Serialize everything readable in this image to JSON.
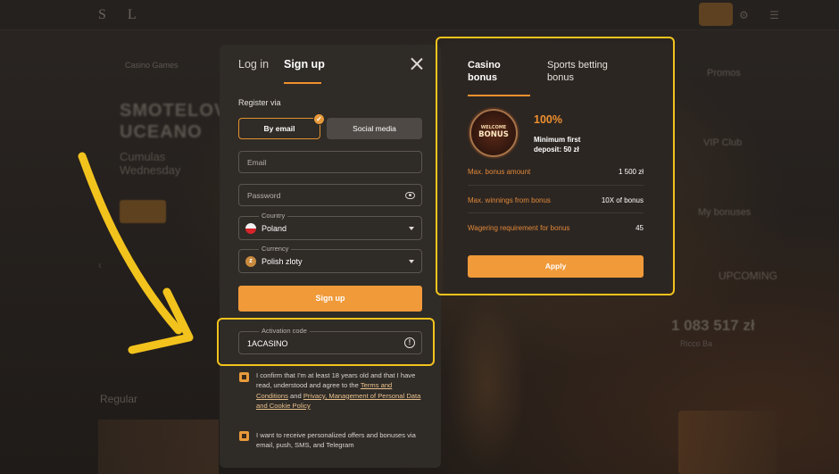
{
  "modal": {
    "tabs": {
      "login": "Log in",
      "signup": "Sign up"
    },
    "register_via": "Register via",
    "by_email": "By email",
    "social_media": "Social media",
    "email_placeholder": "Email",
    "password_placeholder": "Password",
    "country_label": "Country",
    "country_value": "Poland",
    "currency_label": "Currency",
    "currency_value": "Polish zloty",
    "signup_button": "Sign up",
    "activation_label": "Activation code",
    "activation_value": "1ACASINO",
    "consent1_text": "I confirm that I'm at least 18 years old and that I have read, understood and agree to the",
    "consent1_link1": "Terms and Conditions",
    "consent1_and": "and",
    "consent1_link2": "Privacy, Management of Personal Data and Cookie Policy",
    "consent2_text": "I want to receive personalized offers and bonuses via email, push, SMS, and Telegram",
    "icons": {
      "close": "close-icon",
      "eye": "eye-icon",
      "flag": "poland-flag-icon",
      "coin": "coin-icon",
      "caret": "chevron-down-icon",
      "info": "info-icon",
      "check": "check-icon"
    }
  },
  "bonus": {
    "tab_casino": "Casino bonus",
    "tab_sports": "Sports betting bonus",
    "badge_line1": "WELCOME",
    "badge_line2": "BONUS",
    "percent": "100%",
    "min_deposit": "Minimum first deposit: 50 zł",
    "rows": [
      {
        "label": "Max. bonus amount",
        "value": "1 500 zł"
      },
      {
        "label": "Max. winnings from bonus",
        "value": "10X of bonus"
      },
      {
        "label": "Wagering requirement for bonus",
        "value": "45"
      }
    ],
    "apply": "Apply"
  },
  "background": {
    "logo": "S L",
    "nav_item": "Casino Games",
    "hero_title": "SMOTELOV\nUCEANO",
    "hero_sub": "Cumulas\nWednesday",
    "regular": "Regular",
    "promos": "Promos",
    "vip": "VIP Club",
    "my_bonuses": "My bonuses",
    "upcoming": "UPCOMING",
    "jackpot": "1 083 517 zł",
    "jackpot_sub": "Ricco Ba"
  },
  "colors": {
    "accent": "#f09a3a",
    "highlight": "#f2c31d",
    "panel": "#2f2b27",
    "orange_text": "#e0883a"
  }
}
